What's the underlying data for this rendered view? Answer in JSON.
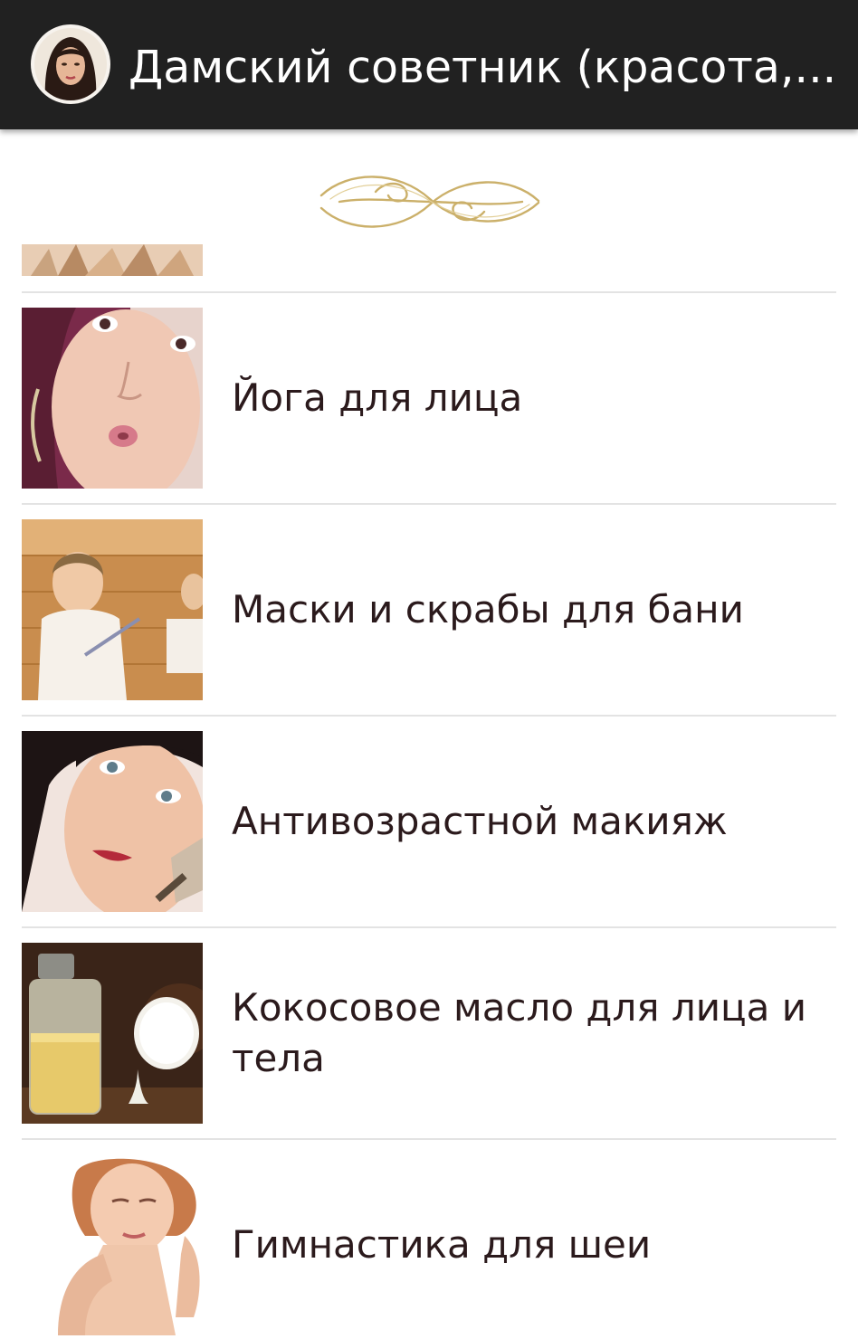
{
  "action_bar": {
    "title": "Дамский советник (красота,..."
  },
  "list": {
    "items": [
      {
        "label": "Йога для лица",
        "image": "face-yoga-photo"
      },
      {
        "label": "Маски и скрабы для бани",
        "image": "sauna-photo"
      },
      {
        "label": "Антивозрастной макияж",
        "image": "makeup-brush-photo"
      },
      {
        "label": "Кокосовое масло для лица и тела",
        "image": "coconut-oil-photo"
      },
      {
        "label": "Гимнастика для шеи",
        "image": "neck-exercise-photo"
      }
    ]
  },
  "colors": {
    "action_bar_bg": "#212121",
    "ornament_gold": "#cbb06a",
    "item_text": "#2b1a1c",
    "divider": "#e3e3e3"
  }
}
